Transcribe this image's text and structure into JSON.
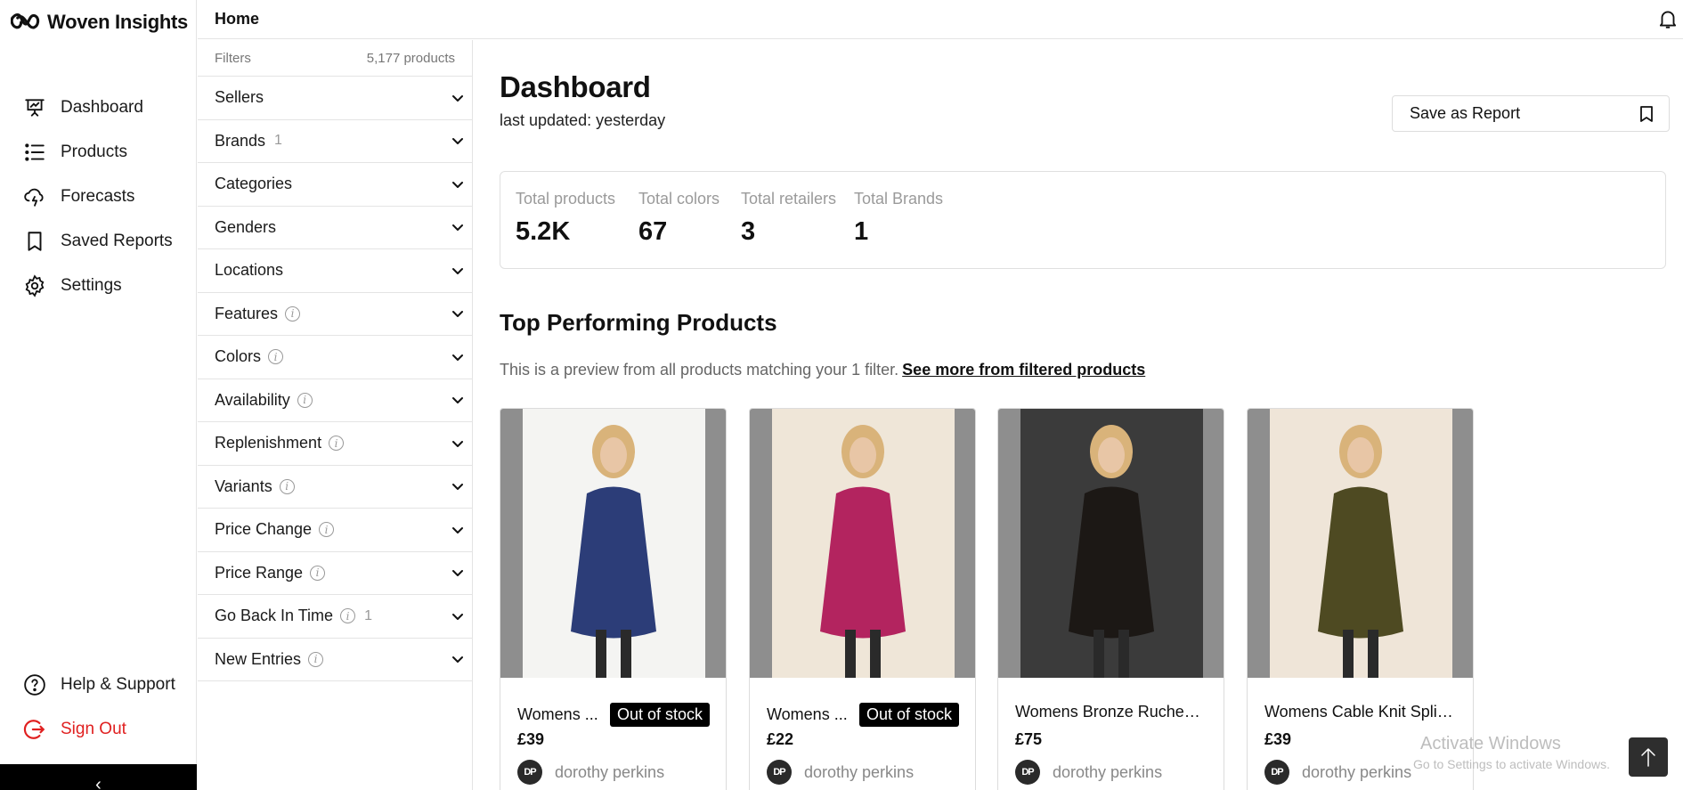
{
  "app": {
    "name": "Woven Insights"
  },
  "nav": {
    "items": [
      {
        "label": "Dashboard",
        "icon": "presentation-icon"
      },
      {
        "label": "Products",
        "icon": "list-icon"
      },
      {
        "label": "Forecasts",
        "icon": "cloud-lightning-icon"
      },
      {
        "label": "Saved Reports",
        "icon": "bookmark-icon"
      },
      {
        "label": "Settings",
        "icon": "gear-icon"
      }
    ],
    "bottom": [
      {
        "label": "Help & Support",
        "icon": "help-circle-icon"
      },
      {
        "label": "Sign Out",
        "icon": "sign-out-icon",
        "color": "#e02020"
      }
    ],
    "collapse_glyph": "‹"
  },
  "topbar": {
    "breadcrumb": "Home"
  },
  "filters": {
    "label": "Filters",
    "count": "5,177 products",
    "rows": [
      {
        "label": "Sellers",
        "info": false,
        "count": ""
      },
      {
        "label": "Brands",
        "info": false,
        "count": "1"
      },
      {
        "label": "Categories",
        "info": false,
        "count": ""
      },
      {
        "label": "Genders",
        "info": false,
        "count": ""
      },
      {
        "label": "Locations",
        "info": false,
        "count": ""
      },
      {
        "label": "Features",
        "info": true,
        "count": ""
      },
      {
        "label": "Colors",
        "info": true,
        "count": ""
      },
      {
        "label": "Availability",
        "info": true,
        "count": ""
      },
      {
        "label": "Replenishment",
        "info": true,
        "count": ""
      },
      {
        "label": "Variants",
        "info": true,
        "count": ""
      },
      {
        "label": "Price Change",
        "info": true,
        "count": ""
      },
      {
        "label": "Price Range",
        "info": true,
        "count": ""
      },
      {
        "label": "Go Back In Time",
        "info": true,
        "count": "1"
      },
      {
        "label": "New Entries",
        "info": true,
        "count": ""
      }
    ]
  },
  "main": {
    "title": "Dashboard",
    "updated": "last updated: yesterday",
    "save_label": "Save as Report",
    "stats": [
      {
        "label": "Total products",
        "value": "5.2K"
      },
      {
        "label": "Total colors",
        "value": "67"
      },
      {
        "label": "Total retailers",
        "value": "3"
      },
      {
        "label": "Total Brands",
        "value": "1"
      }
    ],
    "section_title": "Top Performing Products",
    "preview_text": "This is a preview from all products matching your 1 filter.",
    "preview_link": "See more from filtered products",
    "products": [
      {
        "title": "Womens ...",
        "badge": "Out of stock",
        "price": "£39",
        "seller": "dorothy perkins",
        "seller_initials": "DP",
        "bg": "#f4f4f2",
        "garment": "#2c3d78"
      },
      {
        "title": "Womens ...",
        "badge": "Out of stock",
        "price": "£22",
        "seller": "dorothy perkins",
        "seller_initials": "DP",
        "bg": "#efe6d8",
        "garment": "#b3245f"
      },
      {
        "title": "Womens Bronze Ruched ...",
        "badge": "",
        "price": "£75",
        "seller": "dorothy perkins",
        "seller_initials": "DP",
        "bg": "#3b3b3b",
        "garment": "#1c1815"
      },
      {
        "title": "Womens Cable Knit Split ...",
        "badge": "",
        "price": "£39",
        "seller": "dorothy perkins",
        "seller_initials": "DP",
        "bg": "#efe5d8",
        "garment": "#4e4a22"
      }
    ]
  },
  "overlay": {
    "watermark": "Activate Windows",
    "watermark_sub": "Go to Settings to activate Windows."
  }
}
